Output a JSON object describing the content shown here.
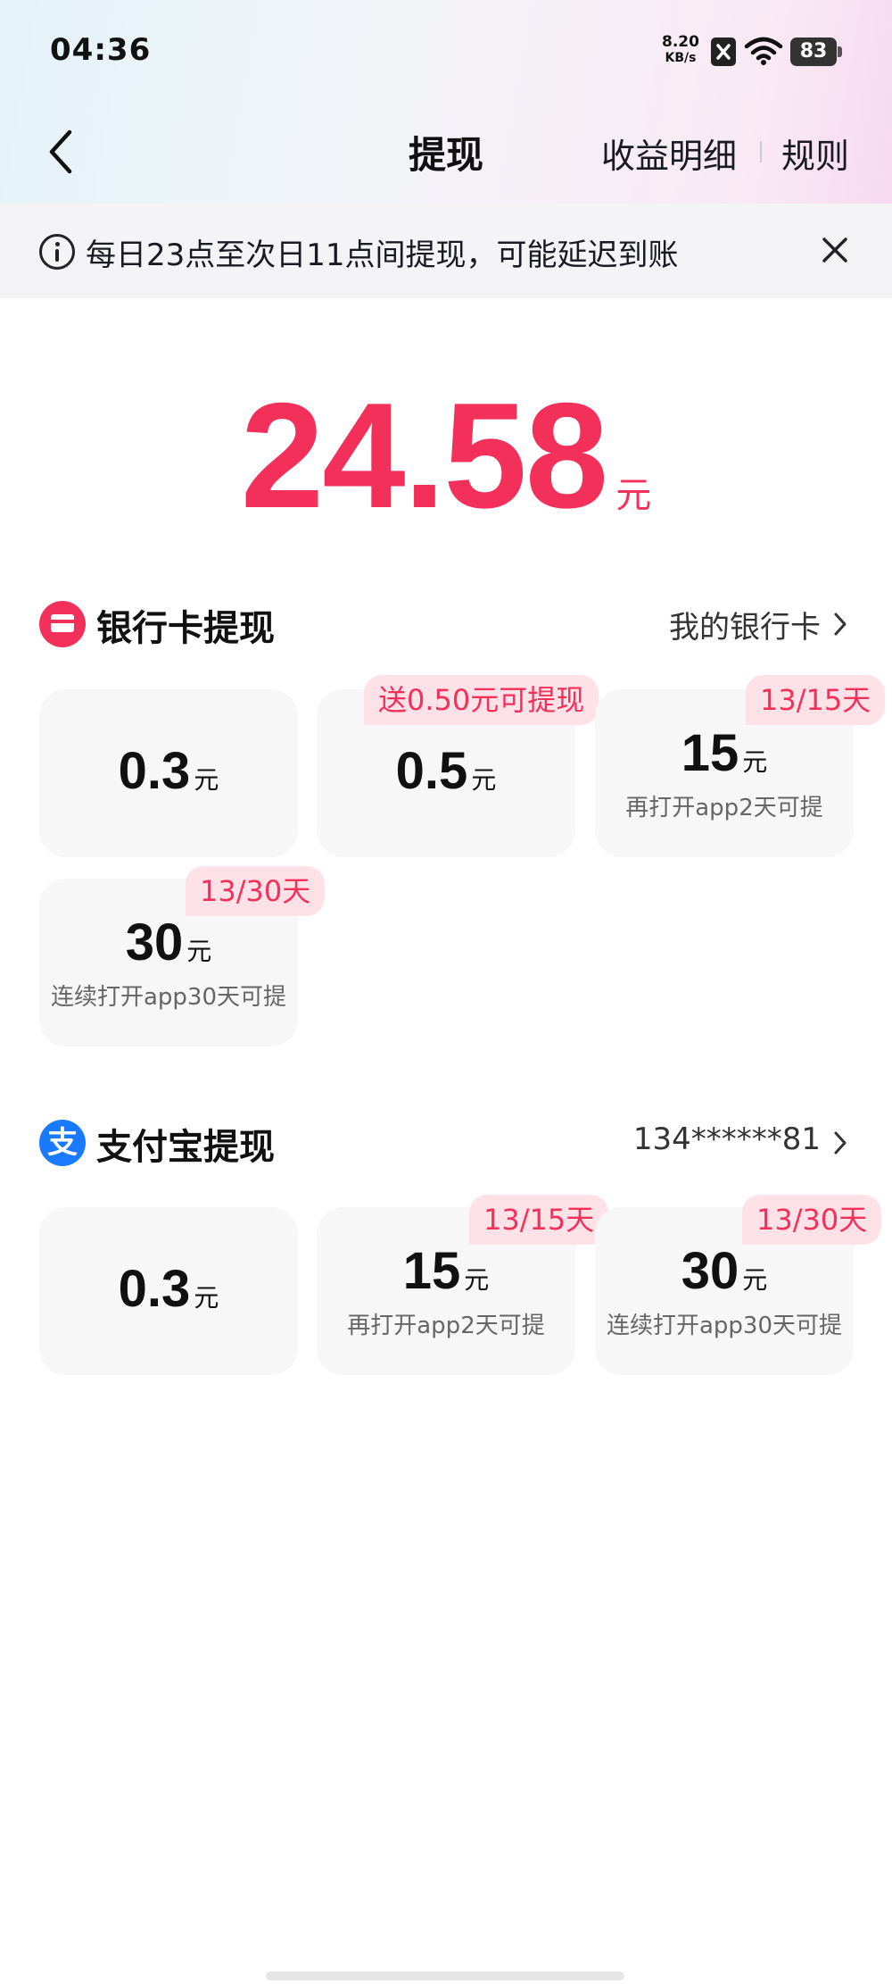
{
  "status_bar": {
    "time": "04:36",
    "net_speed_value": "8.20",
    "net_speed_unit": "KB/s",
    "battery": "83"
  },
  "nav": {
    "title": "提现",
    "detail_label": "收益明细",
    "rules_label": "规则"
  },
  "notice": {
    "text": "每日23点至次日11点间提现，可能延迟到账"
  },
  "balance": {
    "amount": "24.58",
    "unit": "元"
  },
  "bank": {
    "title": "银行卡提现",
    "link": "我的银行卡",
    "options": [
      {
        "value": "0.3",
        "unit": "元",
        "sub": "",
        "badge": ""
      },
      {
        "value": "0.5",
        "unit": "元",
        "sub": "",
        "badge": "送0.50元可提现"
      },
      {
        "value": "15",
        "unit": "元",
        "sub": "再打开app2天可提",
        "badge": "13/15天"
      },
      {
        "value": "30",
        "unit": "元",
        "sub": "连续打开app30天可提",
        "badge": "13/30天"
      }
    ]
  },
  "alipay": {
    "title": "支付宝提现",
    "icon_char": "支",
    "link": "134******81",
    "options": [
      {
        "value": "0.3",
        "unit": "元",
        "sub": "",
        "badge": ""
      },
      {
        "value": "15",
        "unit": "元",
        "sub": "再打开app2天可提",
        "badge": "13/15天"
      },
      {
        "value": "30",
        "unit": "元",
        "sub": "连续打开app30天可提",
        "badge": "13/30天"
      }
    ]
  },
  "colors": {
    "accent": "#f2305a",
    "badge_bg": "#ffe2e8",
    "card_bg": "#f7f7f8",
    "alipay_blue": "#1a7aff"
  }
}
